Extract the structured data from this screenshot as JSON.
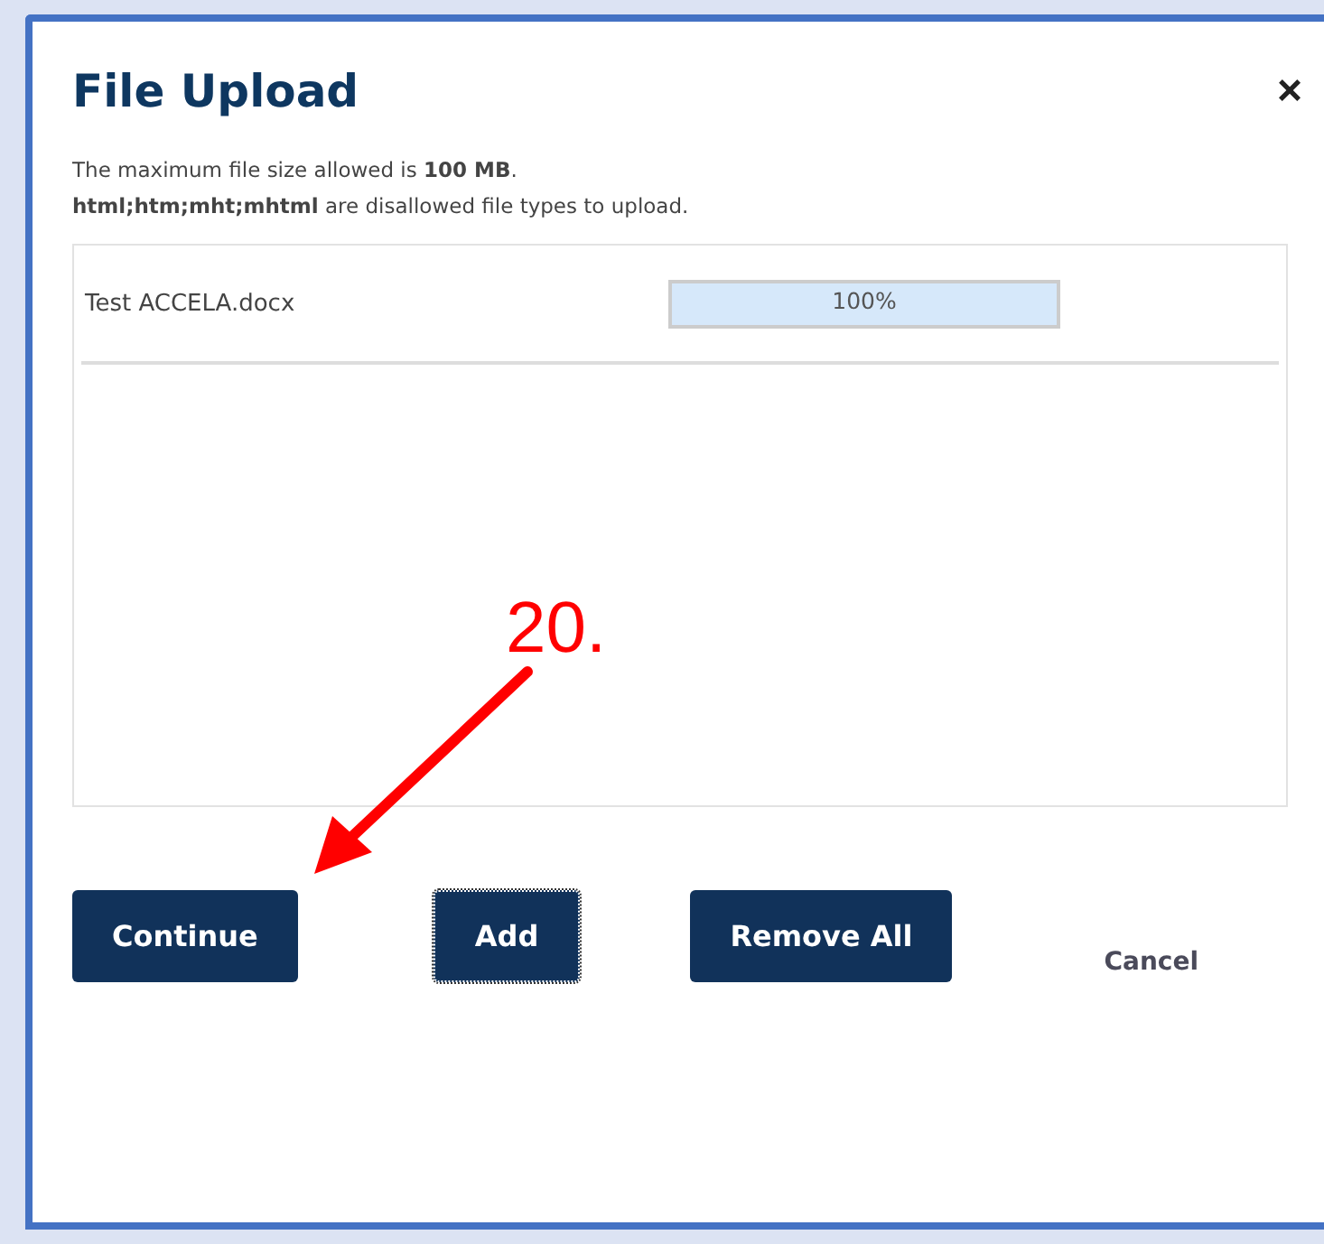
{
  "dialog": {
    "title": "File Upload",
    "close": "×"
  },
  "notes": [
    "The maximum file size allowed is **100 MB**.",
    "**html;htm;mht;mhtml** are disallowed file types to upload."
  ],
  "files": [
    {
      "name": "Test ACCELA.docx",
      "level": 1,
      "reading": "100%"
    }
  ],
  "annotation": {
    "label": "20."
  },
  "buttons": [
    {
      "label": "Continue",
      "kind": "primary",
      "focused": false
    },
    {
      "label": "Add",
      "kind": "primary",
      "focused": true
    },
    {
      "label": "Remove All",
      "kind": "primary",
      "focused": false
    },
    {
      "label": "Cancel",
      "kind": "link"
    }
  ]
}
